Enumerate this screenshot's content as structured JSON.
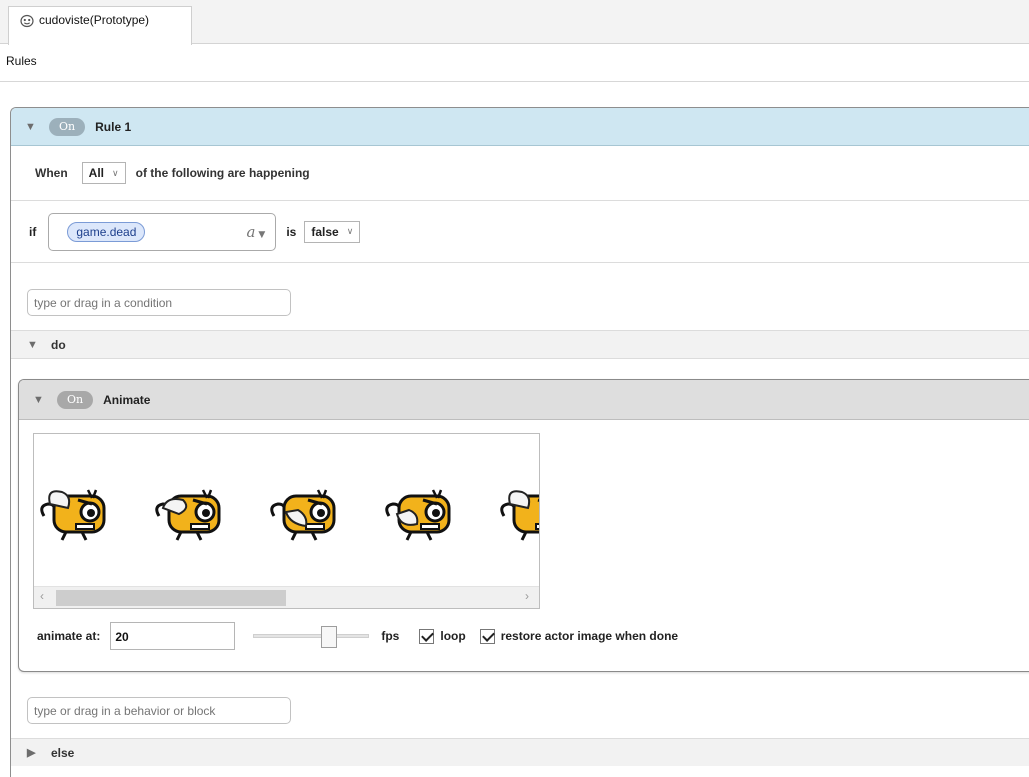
{
  "tab": {
    "label": "cudoviste(Prototype)",
    "icon": "actor-mask-icon"
  },
  "section": {
    "label": "Rules"
  },
  "rule": {
    "toggle": "On",
    "title": "Rule 1",
    "when_label": "When",
    "match_value": "All",
    "when_suffix": "of the following are happening",
    "condition": {
      "if_label": "if",
      "attribute": "game.dead",
      "type_glyph": "a",
      "is_label": "is",
      "value": "false"
    },
    "condition_placeholder": "type or drag in a condition",
    "do_label": "do",
    "behavior": {
      "toggle": "On",
      "title": "Animate",
      "frame_count_visible": 5,
      "animate_label": "animate at:",
      "fps_value": "20",
      "fps_label": "fps",
      "fps_slider_fraction": 0.6,
      "loop_label": "loop",
      "loop_checked": true,
      "restore_label": "restore actor image when done",
      "restore_checked": true
    },
    "behavior_placeholder": "type or drag in a behavior or block",
    "else_label": "else"
  },
  "colors": {
    "rule_header": "#cfe7f2",
    "behavior_header": "#dedede",
    "attribute_pill": "#dce7fb",
    "sprite_body": "#f2b21b"
  }
}
